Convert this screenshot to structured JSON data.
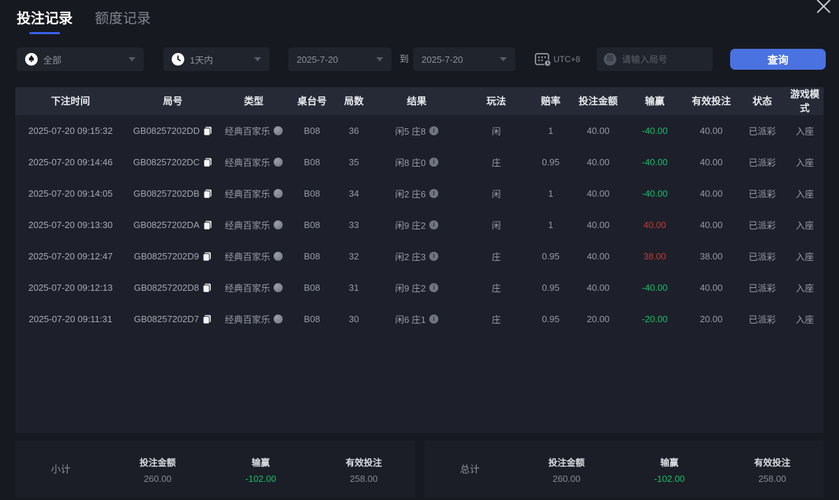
{
  "tabs": [
    {
      "label": "投注记录",
      "active": true
    },
    {
      "label": "额度记录",
      "active": false
    }
  ],
  "filters": {
    "game_type": {
      "value": "全部"
    },
    "time_range": {
      "value": "1天内"
    },
    "date_from": {
      "value": "2025-7-20"
    },
    "to_label": "到",
    "date_to": {
      "value": "2025-7-20"
    },
    "timezone_label": "UTC+8",
    "round_search": {
      "placeholder": "请输入局号",
      "icon_char": "局"
    },
    "query_button_label": "查询"
  },
  "table": {
    "headers": [
      "下注时间",
      "局号",
      "类型",
      "桌台号",
      "局数",
      "结果",
      "玩法",
      "赔率",
      "投注金额",
      "输赢",
      "有效投注",
      "状态",
      "游戏模式"
    ],
    "rows": [
      {
        "time": "2025-07-20 09:15:32",
        "round_id": "GB08257202DD",
        "type": "经典百家乐",
        "table_no": "B08",
        "round_no": "36",
        "result": "闲5 庄8",
        "play": "闲",
        "odds": "1",
        "bet": "40.00",
        "win": "-40.00",
        "win_color": "green",
        "valid": "40.00",
        "status": "已派彩",
        "mode": "入座"
      },
      {
        "time": "2025-07-20 09:14:46",
        "round_id": "GB08257202DC",
        "type": "经典百家乐",
        "table_no": "B08",
        "round_no": "35",
        "result": "闲8 庄0",
        "play": "庄",
        "odds": "0.95",
        "bet": "40.00",
        "win": "-40.00",
        "win_color": "green",
        "valid": "40.00",
        "status": "已派彩",
        "mode": "入座"
      },
      {
        "time": "2025-07-20 09:14:05",
        "round_id": "GB08257202DB",
        "type": "经典百家乐",
        "table_no": "B08",
        "round_no": "34",
        "result": "闲2 庄6",
        "play": "闲",
        "odds": "1",
        "bet": "40.00",
        "win": "-40.00",
        "win_color": "green",
        "valid": "40.00",
        "status": "已派彩",
        "mode": "入座"
      },
      {
        "time": "2025-07-20 09:13:30",
        "round_id": "GB08257202DA",
        "type": "经典百家乐",
        "table_no": "B08",
        "round_no": "33",
        "result": "闲9 庄2",
        "play": "闲",
        "odds": "1",
        "bet": "40.00",
        "win": "40.00",
        "win_color": "red",
        "valid": "40.00",
        "status": "已派彩",
        "mode": "入座"
      },
      {
        "time": "2025-07-20 09:12:47",
        "round_id": "GB08257202D9",
        "type": "经典百家乐",
        "table_no": "B08",
        "round_no": "32",
        "result": "闲2 庄3",
        "play": "庄",
        "odds": "0.95",
        "bet": "40.00",
        "win": "38.00",
        "win_color": "red",
        "valid": "38.00",
        "status": "已派彩",
        "mode": "入座"
      },
      {
        "time": "2025-07-20 09:12:13",
        "round_id": "GB08257202D8",
        "type": "经典百家乐",
        "table_no": "B08",
        "round_no": "31",
        "result": "闲9 庄2",
        "play": "庄",
        "odds": "0.95",
        "bet": "40.00",
        "win": "-40.00",
        "win_color": "green",
        "valid": "40.00",
        "status": "已派彩",
        "mode": "入座"
      },
      {
        "time": "2025-07-20 09:11:31",
        "round_id": "GB08257202D7",
        "type": "经典百家乐",
        "table_no": "B08",
        "round_no": "30",
        "result": "闲6 庄1",
        "play": "庄",
        "odds": "0.95",
        "bet": "20.00",
        "win": "-20.00",
        "win_color": "green",
        "valid": "20.00",
        "status": "已派彩",
        "mode": "入座"
      }
    ]
  },
  "summary": {
    "columns": [
      "投注金额",
      "输赢",
      "有效投注"
    ],
    "subtotal": {
      "label": "小计",
      "bet": "260.00",
      "win": "-102.00",
      "win_color": "green",
      "valid": "258.00"
    },
    "total": {
      "label": "总计",
      "bet": "260.00",
      "win": "-102.00",
      "win_color": "green",
      "valid": "258.00"
    }
  },
  "colors": {
    "accent_blue": "#4a72e0",
    "tab_underline": "#3a62f5",
    "win_red": "#c23a31",
    "loss_green": "#12c06a"
  }
}
